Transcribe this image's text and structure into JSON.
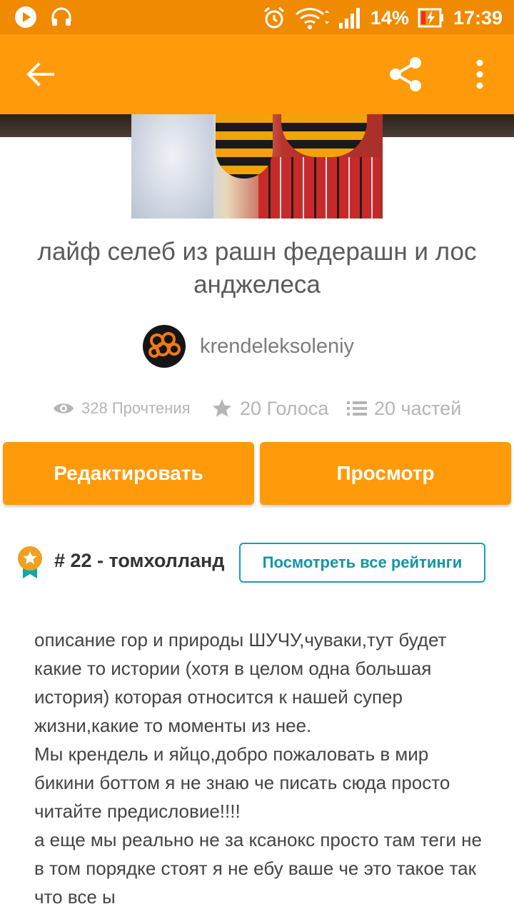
{
  "status_bar": {
    "battery": "14%",
    "time": "17:39",
    "icons": [
      "play-icon",
      "headset-icon",
      "alarm-icon",
      "wifi-icon",
      "signal-icon",
      "battery-charging-icon"
    ]
  },
  "app_bar": {
    "background": "#ff9a0a",
    "icons": [
      "back-arrow-icon",
      "share-icon",
      "more-vert-icon"
    ]
  },
  "story": {
    "title": "лайф селеб из рашн федерашн и лос анджелеса",
    "author": "krendeleksoleniy",
    "stats": {
      "reads": "328 Прочтения",
      "votes": "20 Голоса",
      "parts": "20 частей"
    }
  },
  "actions": {
    "edit_label": "Редактировать",
    "view_label": "Просмотр"
  },
  "ranking": {
    "rank_label": "# 22 - томхолланд",
    "view_all_label": "Посмотреть все рейтинги"
  },
  "description": {
    "paragraphs": [
      "описание гор и природы ШУЧУ,чуваки,тут будет какие то истории (хотя в целом одна большая история) которая относится к нашей супер жизни,какие то моменты из нее.",
      "Мы крендель и яйцо,добро пожаловать в мир бикини боттом я не знаю че писать сюда просто читайте предисловие!!!!",
      "а еще мы реально не за ксанокс просто там теги не в том порядке стоят я не ебу ваше че это такое так что все ы"
    ]
  },
  "colors": {
    "accent": "#ff9a0a",
    "status_bar": "#f08a00",
    "teal": "#12a3b0"
  }
}
